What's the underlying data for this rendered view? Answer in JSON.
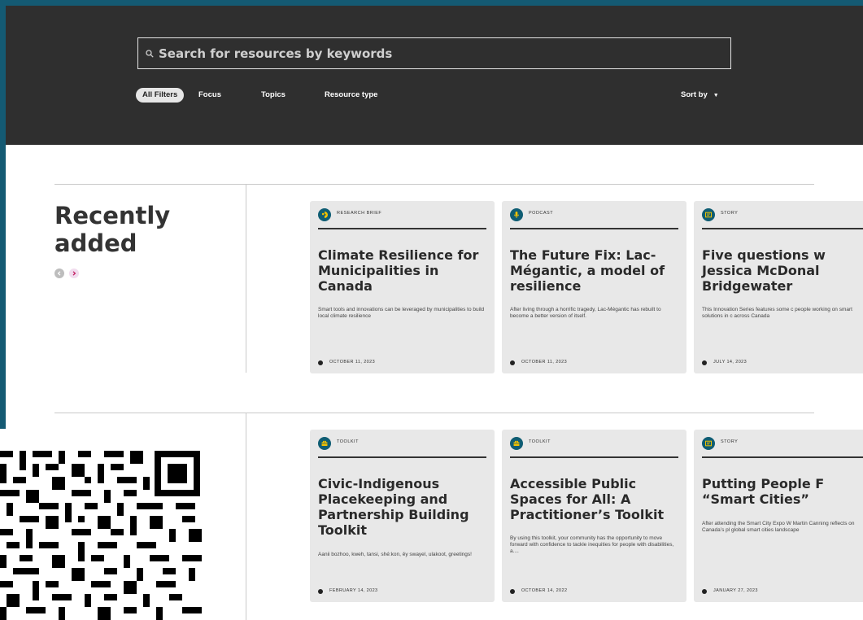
{
  "search": {
    "placeholder": "Search for resources by keywords"
  },
  "filters": {
    "all": "All Filters",
    "focus": "Focus",
    "topics": "Topics",
    "resource_type": "Resource type",
    "sort_by": "Sort by"
  },
  "section": {
    "title": "Recently added"
  },
  "cards": [
    {
      "type": "Research Brief",
      "title": "Climate Resilience for Municipalities in Canada",
      "desc": "Smart tools and innovations can be leveraged by municipalities to build local climate resilience",
      "date": "October 11, 2023",
      "icon": "research-brief-icon"
    },
    {
      "type": "Podcast",
      "title": "The Future Fix: Lac-Mégantic, a model of resilience",
      "desc": "After living through a horrific tragedy, Lac-Mégantic has rebuilt to become a better version of itself.",
      "date": "October 11, 2023",
      "icon": "podcast-icon"
    },
    {
      "type": "Story",
      "title": "Five questions w Jessica McDonal Bridgewater",
      "desc": "This Innovation Series features some c people working on smart solutions in c across Canada",
      "date": "July 14, 2023",
      "icon": "story-icon"
    },
    {
      "type": "Toolkit",
      "title": "Civic-Indigenous Placekeeping and Partnership Building Toolkit",
      "desc": "Aanii bozhoo, kweh, tansi, shé:kon, ěy swayel, ulakoot, greetings!",
      "date": "February 14, 2023",
      "icon": "toolkit-icon"
    },
    {
      "type": "Toolkit",
      "title": "Accessible Public Spaces for All: A Practitioner’s Toolkit",
      "desc": "By using this toolkit, your community has the opportunity to move forward with confidence to tackle inequities for people with disabilities, a....",
      "date": "October 14, 2022",
      "icon": "toolkit-icon"
    },
    {
      "type": "Story",
      "title": "Putting People F “Smart Cities”",
      "desc": "After attending the Smart City Expo W Martin Canning reflects on Canada’s pl global smart cities landscape",
      "date": "January 27, 2023",
      "icon": "story-icon"
    }
  ],
  "colors": {
    "badge": "#0f5d73",
    "badge_glyph": "#f2c200",
    "header_bg": "#2f2f2f",
    "frame": "#145a73"
  }
}
